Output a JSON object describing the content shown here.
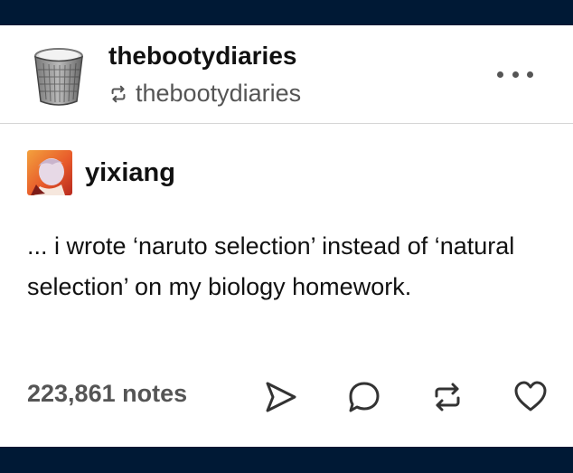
{
  "header": {
    "blog_name": "thebootydiaries",
    "reblogged_from": "thebootydiaries",
    "avatar_icon": "trash-can-icon",
    "more_icon": "more-dots-icon"
  },
  "post": {
    "author": "yixiang",
    "text": "... i wrote ‘naruto selection’ instead of ‘natural selection’ on my biology homework."
  },
  "footer": {
    "notes": "223,861 notes",
    "actions": [
      "share-icon",
      "reply-icon",
      "reblog-icon",
      "heart-icon"
    ]
  },
  "colors": {
    "background": "#001935",
    "card": "#ffffff",
    "muted": "#555555"
  }
}
